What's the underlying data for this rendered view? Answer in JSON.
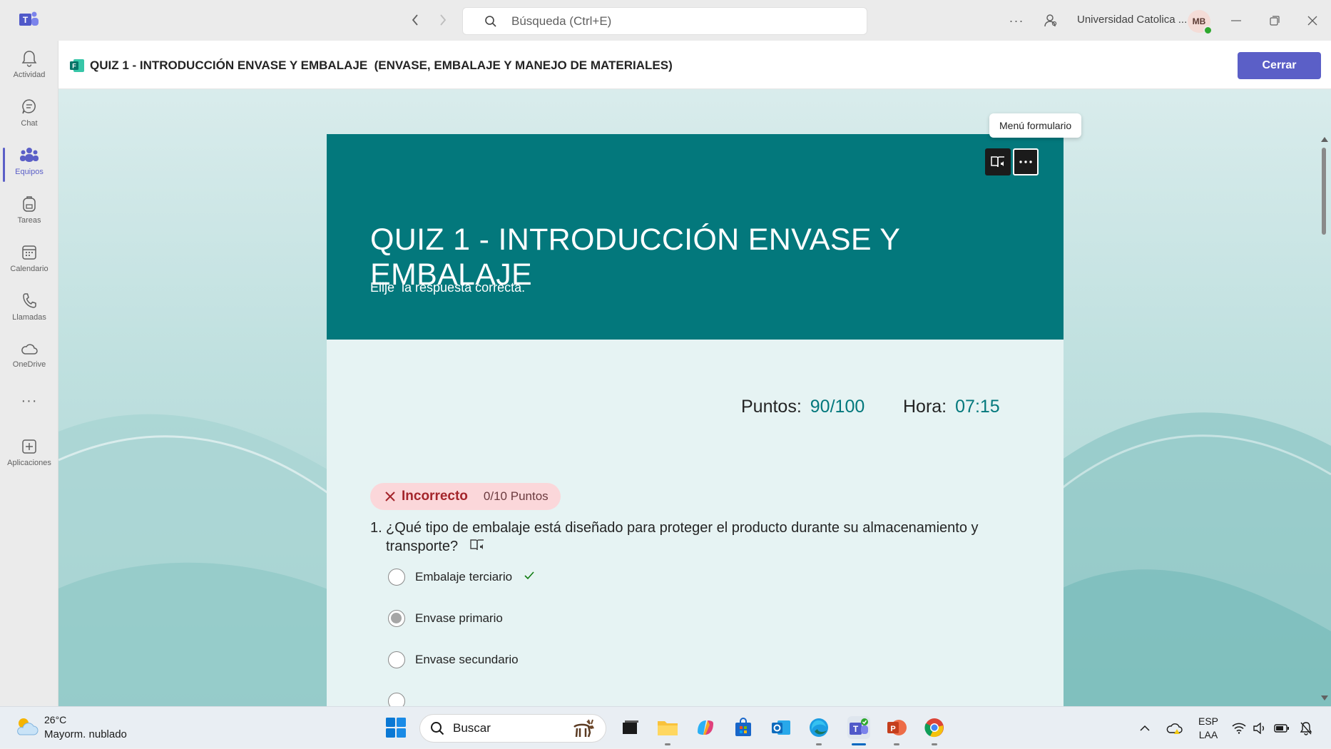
{
  "titlebar": {
    "search_placeholder": "Búsqueda (Ctrl+E)",
    "org_name": "Universidad Catolica ...",
    "avatar_initials": "MB",
    "more_label": "···"
  },
  "rail": {
    "items": [
      {
        "label": "Actividad",
        "icon": "bell-icon"
      },
      {
        "label": "Chat",
        "icon": "chat-icon"
      },
      {
        "label": "Equipos",
        "icon": "teams-icon",
        "active": true
      },
      {
        "label": "Tareas",
        "icon": "backpack-icon"
      },
      {
        "label": "Calendario",
        "icon": "calendar-icon"
      },
      {
        "label": "Llamadas",
        "icon": "phone-icon"
      },
      {
        "label": "OneDrive",
        "icon": "cloud-icon"
      },
      {
        "label": "Aplicaciones",
        "icon": "add-app-icon"
      }
    ],
    "more_label": "···"
  },
  "app_header": {
    "title": "QUIZ 1 - INTRODUCCIÓN ENVASE Y EMBALAJE  (ENVASE, EMBALAJE Y MANEJO DE MATERIALES)",
    "close_label": "Cerrar"
  },
  "form": {
    "tooltip": "Menú formulario",
    "title": "QUIZ 1 - INTRODUCCIÓN ENVASE Y EMBALAJE",
    "subtitle": "Elije  la respuesta correcta.",
    "points_label": "Puntos:",
    "points_value": "90/100",
    "time_label": "Hora:",
    "time_value": "07:15",
    "question": {
      "result": "Incorrecto",
      "result_points": "0/10 Puntos",
      "number": "1.",
      "text": "¿Qué tipo de embalaje está diseñado para proteger el producto durante su almacenamiento y transporte?",
      "options": [
        {
          "label": "Embalaje terciario",
          "selected": false,
          "correct": true
        },
        {
          "label": "Envase primario",
          "selected": true,
          "correct": false
        },
        {
          "label": "Envase secundario",
          "selected": false,
          "correct": false
        }
      ]
    }
  },
  "taskbar": {
    "weather_temp": "26°C",
    "weather_desc": "Mayorm. nublado",
    "search_label": "Buscar",
    "lang_line1": "ESP",
    "lang_line2": "LAA"
  },
  "colors": {
    "brand": "#5b5fc7",
    "form_theme": "#03787c",
    "incorrect": "#a4262c",
    "correct": "#107c10"
  }
}
